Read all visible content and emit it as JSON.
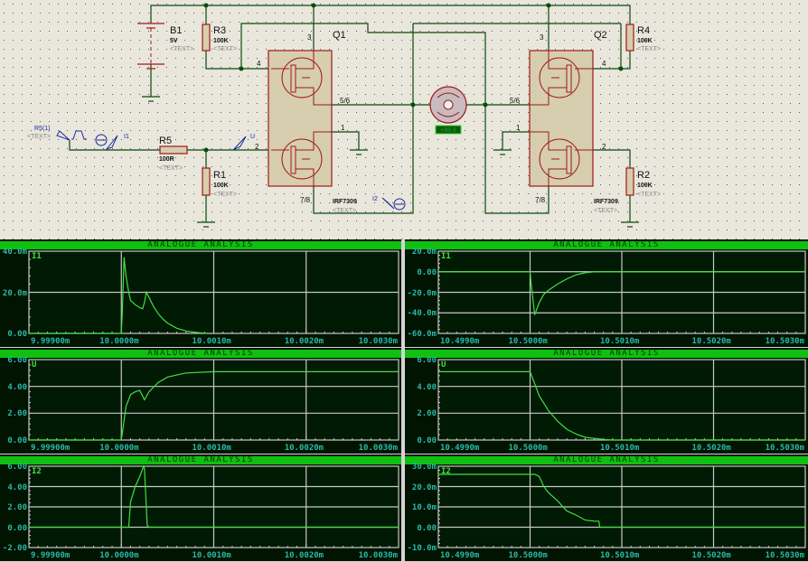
{
  "schematic": {
    "B1": {
      "name": "B1",
      "value": "5V",
      "text": "<TEXT>"
    },
    "R3": {
      "name": "R3",
      "value": "100K",
      "text": "<TEXT>"
    },
    "R4": {
      "name": "R4",
      "value": "100K",
      "text": "<TEXT>"
    },
    "R5": {
      "name": "R5",
      "value": "100R",
      "text": "<TEXT>"
    },
    "R1": {
      "name": "R1",
      "value": "100K",
      "text": "<TEXT>"
    },
    "R2": {
      "name": "R2",
      "value": "100K",
      "text": "<TEXT>"
    },
    "Q1": {
      "name": "Q1",
      "part": "IRF7309",
      "text": "<TEXT>",
      "pins": {
        "p3": "3",
        "p4": "4",
        "p56": "5/6",
        "p1": "1",
        "p2": "2",
        "p78": "7/8"
      }
    },
    "Q2": {
      "name": "Q2",
      "part": "IRF7309",
      "text": "<TEXT>",
      "pins": {
        "p3": "3",
        "p4": "4",
        "p56": "5/6",
        "p1": "1",
        "p2": "2",
        "p78": "7/8"
      }
    },
    "generator": {
      "name": "R5(1)",
      "text": "<TEXT>"
    },
    "probes": {
      "i1": "I1",
      "u": "U",
      "i2": "I2"
    },
    "motor_display": "+88.8",
    "colors": {
      "wire": "#0a4a0a",
      "component": "#a01818",
      "body": "#d6ceae",
      "probe": "#1a2aa0"
    }
  },
  "graphs_title": "ANALOGUE ANALYSIS",
  "colors": {
    "trace": "#40e040",
    "grid": "#c8c8c8",
    "labels": "#2ab8a8",
    "titlebar": "#10c010"
  },
  "chart_data": [
    {
      "type": "line",
      "title": "ANALOGUE ANALYSIS",
      "trace": "I1",
      "xlim": [
        9.999,
        10.003
      ],
      "ylim": [
        0,
        40
      ],
      "xticks": [
        "9.99900m",
        "10.0000m",
        "10.0010m",
        "10.0020m",
        "10.0030m"
      ],
      "yticks": [
        "0.00",
        "20.0m",
        "40.0m"
      ],
      "x": [
        9.999,
        10.0,
        10.00001,
        10.00003,
        10.00005,
        10.00008,
        10.0001,
        10.00015,
        10.0002,
        10.00023,
        10.00025,
        10.00027,
        10.0003,
        10.00035,
        10.0004,
        10.00045,
        10.0005,
        10.0006,
        10.0007,
        10.0008,
        10.00093
      ],
      "y": [
        0,
        0,
        10,
        37,
        28,
        20,
        16,
        14,
        12.5,
        12,
        15,
        20,
        17.5,
        13,
        9.5,
        7,
        5,
        2.5,
        1.2,
        0.5,
        0
      ]
    },
    {
      "type": "line",
      "title": "ANALOGUE ANALYSIS",
      "trace": "I1",
      "xlim": [
        10.499,
        10.503
      ],
      "ylim": [
        -60,
        20
      ],
      "xticks": [
        "10.4990m",
        "10.5000m",
        "10.5010m",
        "10.5020m",
        "10.5030m"
      ],
      "yticks": [
        "-60.0m",
        "-40.0m",
        "-20.0m",
        "0.00",
        "20.0m"
      ],
      "x": [
        10.499,
        10.5,
        10.50001,
        10.50005,
        10.5001,
        10.50015,
        10.5002,
        10.5003,
        10.5004,
        10.5005,
        10.5006,
        10.5007,
        10.503
      ],
      "y": [
        0,
        0,
        -10,
        -42,
        -30,
        -22,
        -18,
        -12,
        -7,
        -3,
        -1,
        0,
        0
      ]
    },
    {
      "type": "line",
      "title": "ANALOGUE ANALYSIS",
      "trace": "U",
      "xlim": [
        9.999,
        10.003
      ],
      "ylim": [
        0,
        6
      ],
      "xticks": [
        "9.99900m",
        "10.0000m",
        "10.0010m",
        "10.0020m",
        "10.0030m"
      ],
      "yticks": [
        "0.00",
        "2.00",
        "4.00",
        "6.00"
      ],
      "x": [
        9.999,
        10.0,
        10.00002,
        10.00005,
        10.0001,
        10.00015,
        10.0002,
        10.00025,
        10.0003,
        10.0004,
        10.0005,
        10.0007,
        10.001,
        10.003
      ],
      "y": [
        0,
        0,
        1,
        2.5,
        3.4,
        3.6,
        3.7,
        3.0,
        3.6,
        4.3,
        4.7,
        5.0,
        5.1,
        5.1
      ]
    },
    {
      "type": "line",
      "title": "ANALOGUE ANALYSIS",
      "trace": "U",
      "xlim": [
        10.499,
        10.503
      ],
      "ylim": [
        0,
        6
      ],
      "xticks": [
        "10.4990m",
        "10.5000m",
        "10.5010m",
        "10.5020m",
        "10.5030m"
      ],
      "yticks": [
        "0.00",
        "2.00",
        "4.00",
        "6.00"
      ],
      "x": [
        10.499,
        10.5,
        10.50005,
        10.5001,
        10.5002,
        10.5003,
        10.5004,
        10.5005,
        10.5006,
        10.5008,
        10.5009,
        10.503
      ],
      "y": [
        5.1,
        5.1,
        4.2,
        3.3,
        2.2,
        1.4,
        0.8,
        0.45,
        0.2,
        0.05,
        0,
        0
      ]
    },
    {
      "type": "line",
      "title": "ANALOGUE ANALYSIS",
      "trace": "I2",
      "xlim": [
        9.999,
        10.003
      ],
      "ylim": [
        -2,
        6
      ],
      "xticks": [
        "9.99900m",
        "10.0000m",
        "10.0010m",
        "10.0020m",
        "10.0030m"
      ],
      "yticks": [
        "-2.00",
        "0.00",
        "2.00",
        "4.00",
        "6.00"
      ],
      "x": [
        9.999,
        10.00008,
        10.0001,
        10.00015,
        10.0002,
        10.00024,
        10.00025,
        10.00027,
        10.00028,
        10.0003,
        10.003
      ],
      "y": [
        0,
        0,
        2.5,
        4,
        5,
        6,
        5.8,
        2,
        0.2,
        0,
        0
      ]
    },
    {
      "type": "line",
      "title": "ANALOGUE ANALYSIS",
      "trace": "I2",
      "xlim": [
        10.499,
        10.503
      ],
      "ylim": [
        -10,
        30
      ],
      "xticks": [
        "10.4990m",
        "10.5000m",
        "10.5010m",
        "10.5020m",
        "10.5030m"
      ],
      "yticks": [
        "-10.0m",
        "0.00",
        "10.0m",
        "20.0m",
        "30.0m"
      ],
      "x": [
        10.499,
        10.5,
        10.50005,
        10.5001,
        10.50015,
        10.5002,
        10.5003,
        10.5004,
        10.5005,
        10.5006,
        10.5007,
        10.50075,
        10.50076,
        10.503
      ],
      "y": [
        26,
        26,
        26,
        25,
        20,
        17,
        13,
        8,
        6,
        3.5,
        3,
        3,
        0,
        0
      ]
    }
  ]
}
